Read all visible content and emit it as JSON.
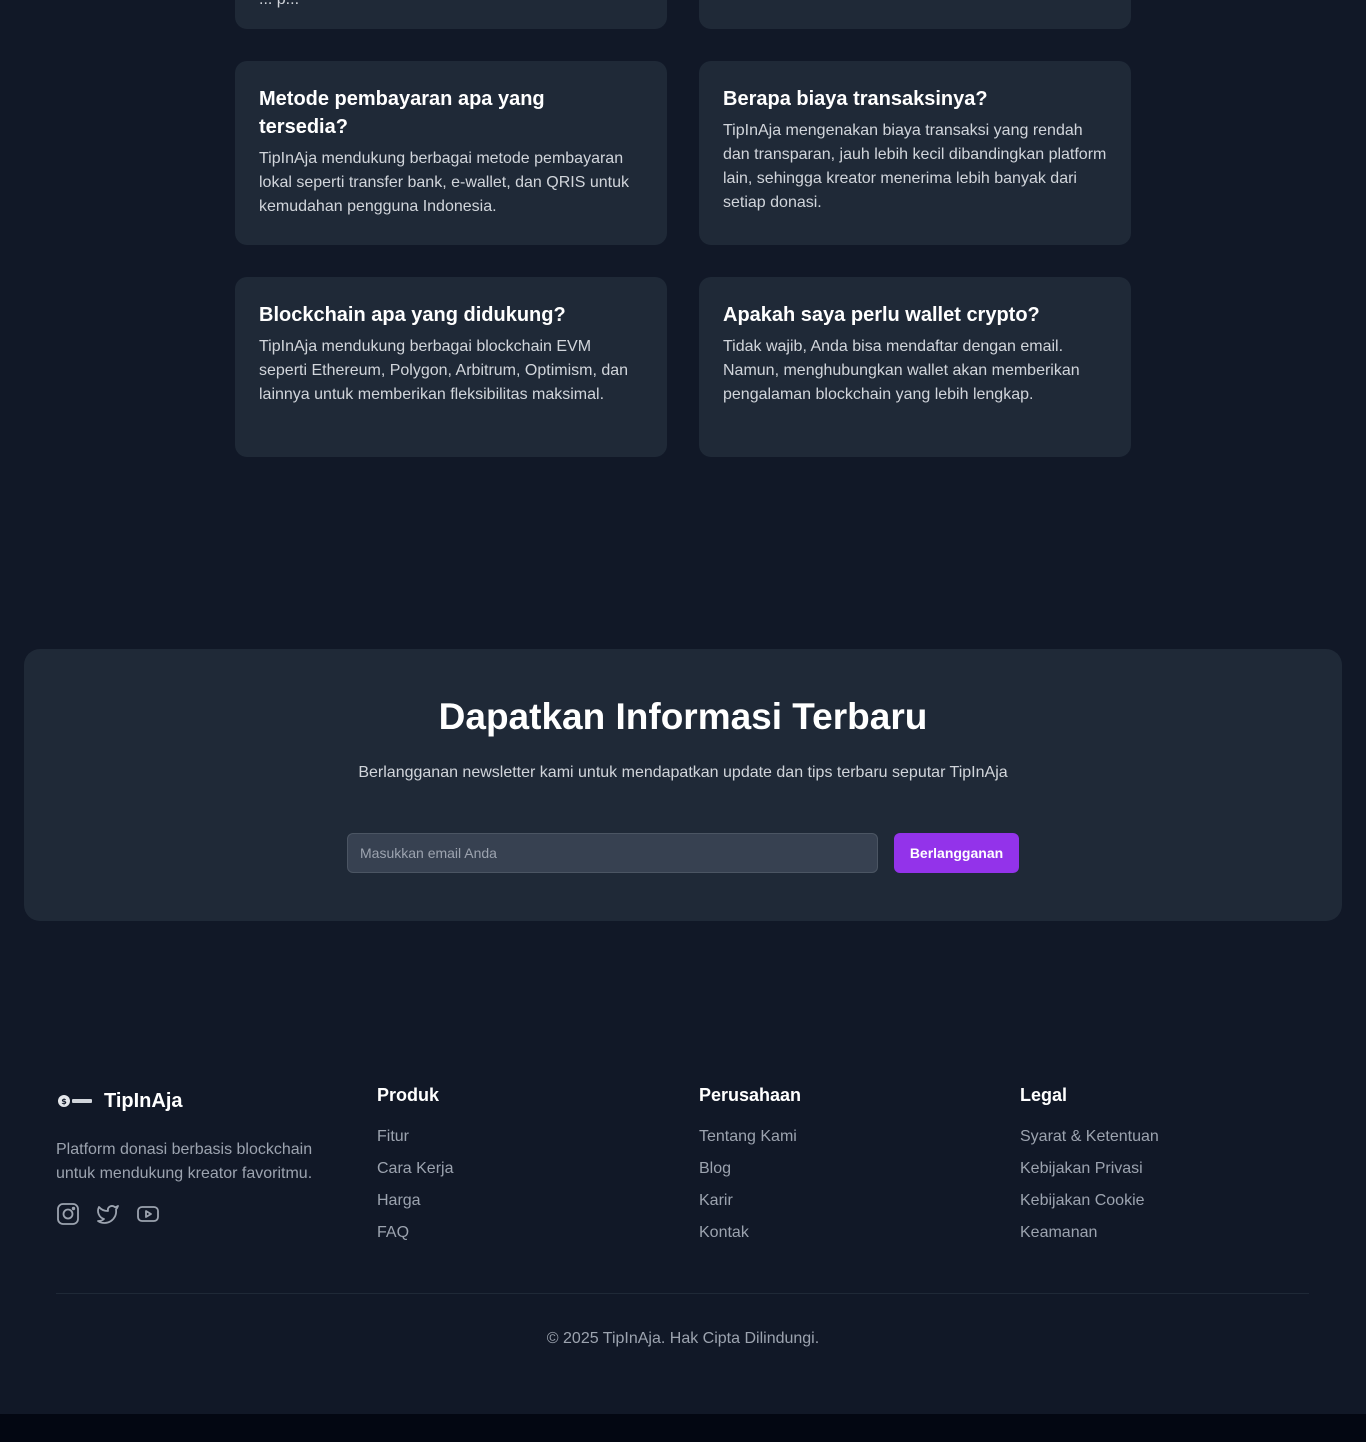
{
  "faq": {
    "partial_left_text": "... p...",
    "items": [
      {
        "question": "Metode pembayaran apa yang tersedia?",
        "answer": "TipInAja mendukung berbagai metode pembayaran lokal seperti transfer bank, e-wallet, dan QRIS untuk kemudahan pengguna Indonesia."
      },
      {
        "question": "Berapa biaya transaksinya?",
        "answer": "TipInAja mengenakan biaya transaksi yang rendah dan transparan, jauh lebih kecil dibandingkan platform lain, sehingga kreator menerima lebih banyak dari setiap donasi."
      },
      {
        "question": "Blockchain apa yang didukung?",
        "answer": "TipInAja mendukung berbagai blockchain EVM seperti Ethereum, Polygon, Arbitrum, Optimism, dan lainnya untuk memberikan fleksibilitas maksimal."
      },
      {
        "question": "Apakah saya perlu wallet crypto?",
        "answer": "Tidak wajib, Anda bisa mendaftar dengan email. Namun, menghubungkan wallet akan memberikan pengalaman blockchain yang lebih lengkap."
      }
    ]
  },
  "newsletter": {
    "title": "Dapatkan Informasi Terbaru",
    "description": "Berlangganan newsletter kami untuk mendapatkan update dan tips terbaru seputar TipInAja",
    "email_placeholder": "Masukkan email Anda",
    "email_value": "",
    "subscribe_label": "Berlangganan"
  },
  "footer": {
    "brand_name": "TipInAja",
    "logo_text": "TipInAja",
    "description": "Platform donasi berbasis blockchain untuk mendukung kreator favoritmu.",
    "socials": [
      "instagram-icon",
      "twitter-icon",
      "youtube-icon"
    ],
    "columns": [
      {
        "title": "Produk",
        "links": [
          "Fitur",
          "Cara Kerja",
          "Harga",
          "FAQ"
        ]
      },
      {
        "title": "Perusahaan",
        "links": [
          "Tentang Kami",
          "Blog",
          "Karir",
          "Kontak"
        ]
      },
      {
        "title": "Legal",
        "links": [
          "Syarat & Ketentuan",
          "Kebijakan Privasi",
          "Kebijakan Cookie",
          "Keamanan"
        ]
      }
    ],
    "copyright": "© 2025 TipInAja. Hak Cipta Dilindungi."
  },
  "colors": {
    "background": "#111827",
    "card": "#1f2937",
    "accent": "#9333ea",
    "muted_text": "#9ca3af"
  }
}
